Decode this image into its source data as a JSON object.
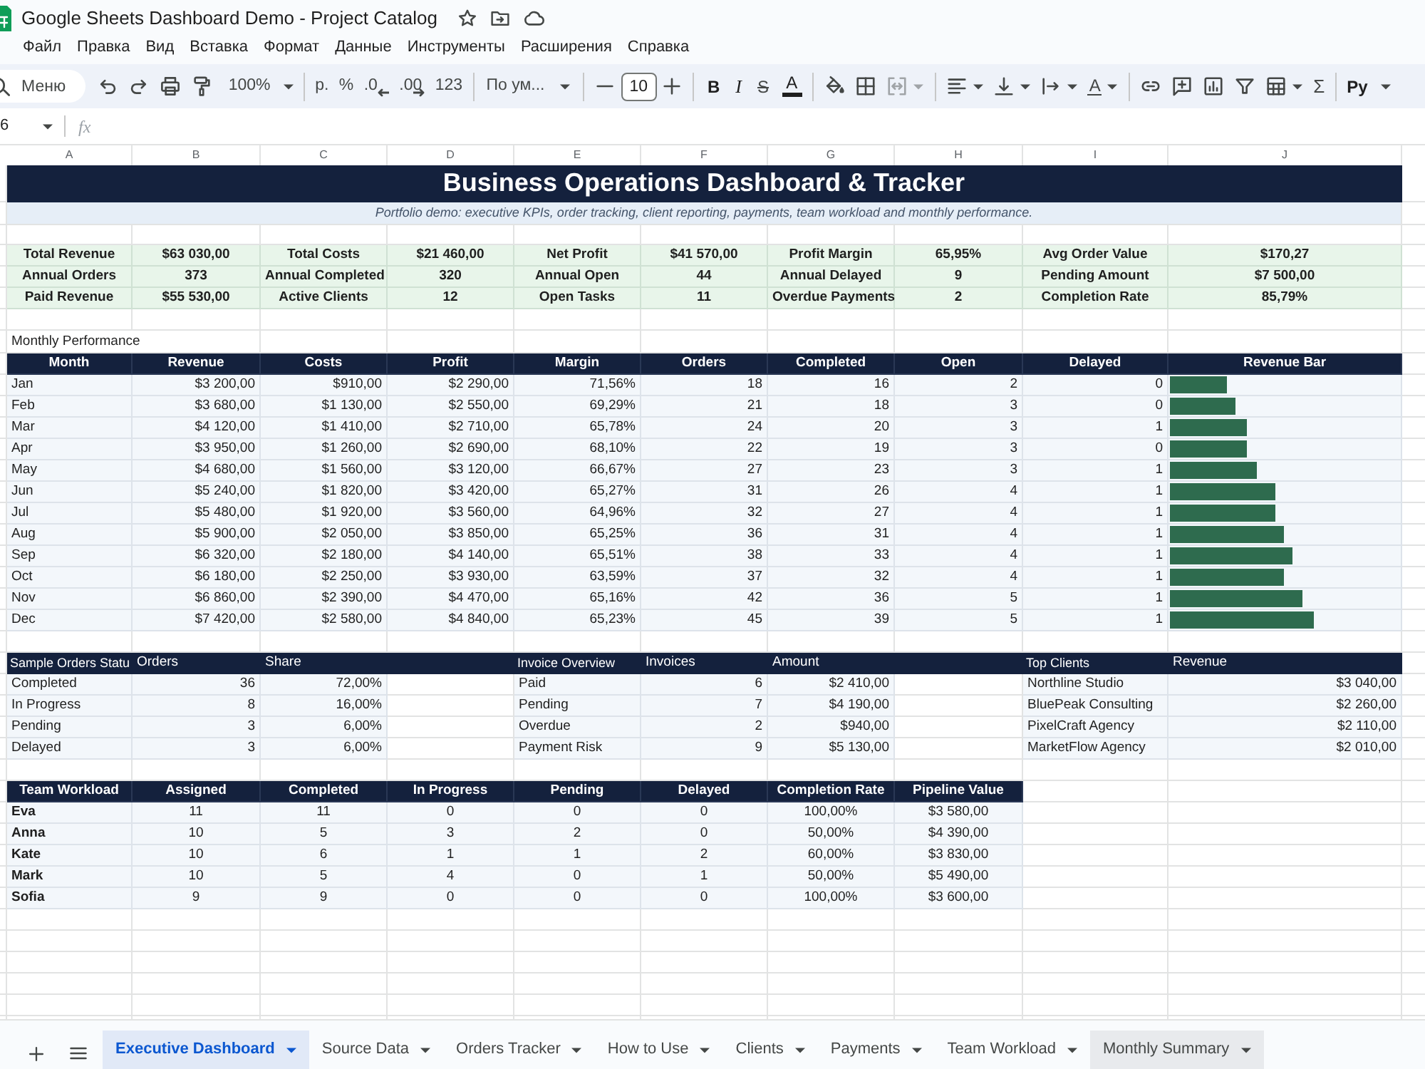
{
  "window": {
    "title": "Google Sheets Dashboard Demo - Project Catalog"
  },
  "menu": [
    "Файл",
    "Правка",
    "Вид",
    "Вставка",
    "Формат",
    "Данные",
    "Инструменты",
    "Расширения",
    "Справка"
  ],
  "toolbar": {
    "search": {
      "placeholder": "Меню"
    },
    "zoom": "100%",
    "currency": "р.",
    "percent": "%",
    "decimal_decrease": ".0",
    "decimal_increase": ".00",
    "number_format": "123",
    "font": "По ум...",
    "font_size": "10",
    "bold": "B",
    "italic": "I",
    "strikethrough": "S",
    "text_color": "A",
    "merge": {
      "disabled": true
    },
    "text_rotation": "A",
    "functions": "Σ",
    "input_tools": "Ру"
  },
  "formula_bar": {
    "cell_ref": "6",
    "fx": "fx"
  },
  "column_headers": [
    "A",
    "B",
    "C",
    "D",
    "E",
    "F",
    "G",
    "H",
    "I",
    "J"
  ],
  "sheet": {
    "banner": {
      "title": "Business Operations Dashboard & Tracker",
      "subtitle": "Portfolio demo: executive KPIs, order tracking, client reporting, payments, team workload and monthly performance."
    },
    "kpis": [
      [
        {
          "label": "Total Revenue",
          "value": "$63 030,00"
        },
        {
          "label": "Total Costs",
          "value": "$21 460,00"
        },
        {
          "label": "Net Profit",
          "value": "$41 570,00"
        },
        {
          "label": "Profit Margin",
          "value": "65,95%"
        },
        {
          "label": "Avg Order Value",
          "value": "$170,27"
        }
      ],
      [
        {
          "label": "Annual Orders",
          "value": "373"
        },
        {
          "label": "Annual Completed",
          "value": "320"
        },
        {
          "label": "Annual Open",
          "value": "44"
        },
        {
          "label": "Annual Delayed",
          "value": "9"
        },
        {
          "label": "Pending Amount",
          "value": "$7 500,00"
        }
      ],
      [
        {
          "label": "Paid Revenue",
          "value": "$55 530,00"
        },
        {
          "label": "Active Clients",
          "value": "12"
        },
        {
          "label": "Open Tasks",
          "value": "11"
        },
        {
          "label": "Overdue Payments",
          "value": "2"
        },
        {
          "label": "Completion Rate",
          "value": "85,79%"
        }
      ]
    ],
    "monthly": {
      "caption": "Monthly Performance",
      "columns": [
        "Month",
        "Revenue",
        "Costs",
        "Profit",
        "Margin",
        "Orders",
        "Completed",
        "Open",
        "Delayed",
        "Revenue Bar"
      ],
      "rows": [
        {
          "cells": [
            "Jan",
            "$3 200,00",
            "$910,00",
            "$2 290,00",
            "71,56%",
            "18",
            "16",
            "2",
            "0"
          ],
          "level": 0.25
        },
        {
          "cells": [
            "Feb",
            "$3 680,00",
            "$1 130,00",
            "$2 550,00",
            "69,29%",
            "21",
            "18",
            "3",
            "0"
          ],
          "level": 0.29
        },
        {
          "cells": [
            "Mar",
            "$4 120,00",
            "$1 410,00",
            "$2 710,00",
            "65,78%",
            "24",
            "20",
            "3",
            "1"
          ],
          "level": 0.34
        },
        {
          "cells": [
            "Apr",
            "$3 950,00",
            "$1 260,00",
            "$2 690,00",
            "68,10%",
            "22",
            "19",
            "3",
            "0"
          ],
          "level": 0.34
        },
        {
          "cells": [
            "May",
            "$4 680,00",
            "$1 560,00",
            "$3 120,00",
            "66,67%",
            "27",
            "23",
            "3",
            "1"
          ],
          "level": 0.38
        },
        {
          "cells": [
            "Jun",
            "$5 240,00",
            "$1 820,00",
            "$3 420,00",
            "65,27%",
            "31",
            "26",
            "4",
            "1"
          ],
          "level": 0.46
        },
        {
          "cells": [
            "Jul",
            "$5 480,00",
            "$1 920,00",
            "$3 560,00",
            "64,96%",
            "32",
            "27",
            "4",
            "1"
          ],
          "level": 0.46
        },
        {
          "cells": [
            "Aug",
            "$5 900,00",
            "$2 050,00",
            "$3 850,00",
            "65,25%",
            "36",
            "31",
            "4",
            "1"
          ],
          "level": 0.5
        },
        {
          "cells": [
            "Sep",
            "$6 320,00",
            "$2 180,00",
            "$4 140,00",
            "65,51%",
            "38",
            "33",
            "4",
            "1"
          ],
          "level": 0.54
        },
        {
          "cells": [
            "Oct",
            "$6 180,00",
            "$2 250,00",
            "$3 930,00",
            "63,59%",
            "37",
            "32",
            "4",
            "1"
          ],
          "level": 0.5
        },
        {
          "cells": [
            "Nov",
            "$6 860,00",
            "$2 390,00",
            "$4 470,00",
            "65,16%",
            "42",
            "36",
            "5",
            "1"
          ],
          "level": 0.58
        },
        {
          "cells": [
            "Dec",
            "$7 420,00",
            "$2 580,00",
            "$4 840,00",
            "65,23%",
            "45",
            "39",
            "5",
            "1"
          ],
          "level": 0.63
        }
      ]
    },
    "orders_status": {
      "columns": [
        "Sample Orders Statu",
        "Orders",
        "Share"
      ],
      "rows": [
        [
          "Completed",
          "36",
          "72,00%"
        ],
        [
          "In Progress",
          "8",
          "16,00%"
        ],
        [
          "Pending",
          "3",
          "6,00%"
        ],
        [
          "Delayed",
          "3",
          "6,00%"
        ]
      ]
    },
    "invoice_overview": {
      "columns": [
        "Invoice Overview",
        "Invoices",
        "Amount"
      ],
      "rows": [
        [
          "Paid",
          "6",
          "$2 410,00"
        ],
        [
          "Pending",
          "7",
          "$4 190,00"
        ],
        [
          "Overdue",
          "2",
          "$940,00"
        ],
        [
          "Payment Risk",
          "9",
          "$5 130,00"
        ]
      ]
    },
    "top_clients": {
      "columns": [
        "Top Clients",
        "Revenue"
      ],
      "rows": [
        [
          "Northline Studio",
          "$3 040,00"
        ],
        [
          "BluePeak Consulting",
          "$2 260,00"
        ],
        [
          "PixelCraft Agency",
          "$2 110,00"
        ],
        [
          "MarketFlow Agency",
          "$2 010,00"
        ]
      ]
    },
    "team_workload": {
      "columns": [
        "Team Workload",
        "Assigned",
        "Completed",
        "In Progress",
        "Pending",
        "Delayed",
        "Completion Rate",
        "Pipeline Value"
      ],
      "rows": [
        [
          "Eva",
          "11",
          "11",
          "0",
          "0",
          "0",
          "100,00%",
          "$3 580,00"
        ],
        [
          "Anna",
          "10",
          "5",
          "3",
          "2",
          "0",
          "50,00%",
          "$4 390,00"
        ],
        [
          "Kate",
          "10",
          "6",
          "1",
          "1",
          "2",
          "60,00%",
          "$3 830,00"
        ],
        [
          "Mark",
          "10",
          "5",
          "4",
          "0",
          "1",
          "50,00%",
          "$5 490,00"
        ],
        [
          "Sofia",
          "9",
          "9",
          "0",
          "0",
          "0",
          "100,00%",
          "$3 600,00"
        ]
      ]
    }
  },
  "sheet_tabs": [
    {
      "label": "Executive Dashboard",
      "selected": true,
      "hovered": false
    },
    {
      "label": "Source Data",
      "selected": false,
      "hovered": false
    },
    {
      "label": "Orders Tracker",
      "selected": false,
      "hovered": false
    },
    {
      "label": "How to Use",
      "selected": false,
      "hovered": false
    },
    {
      "label": "Clients",
      "selected": false,
      "hovered": false
    },
    {
      "label": "Payments",
      "selected": false,
      "hovered": false
    },
    {
      "label": "Team Workload",
      "selected": false,
      "hovered": false
    },
    {
      "label": "Monthly Summary",
      "selected": false,
      "hovered": true
    }
  ]
}
